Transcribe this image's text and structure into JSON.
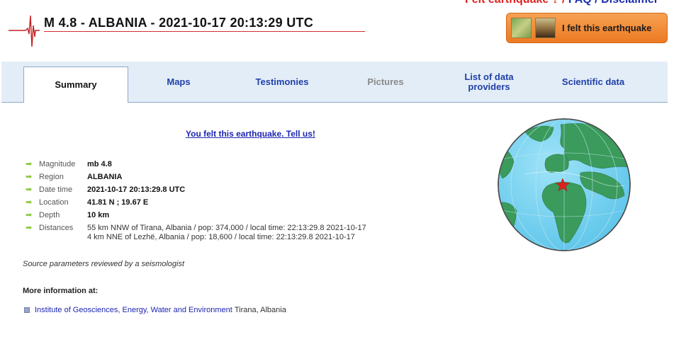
{
  "top_links": {
    "felt": "Felt earthquake ?",
    "faq": "FAQ",
    "disclaimer": "Disclaimer"
  },
  "header": {
    "title": "M 4.8 - ALBANIA - 2021-10-17 20:13:29 UTC",
    "felt_button": "I felt this earthquake"
  },
  "tabs": [
    {
      "label": "Summary"
    },
    {
      "label": "Maps"
    },
    {
      "label": "Testimonies"
    },
    {
      "label": "Pictures"
    },
    {
      "label": "List of data providers"
    },
    {
      "label": "Scientific data"
    }
  ],
  "tell_us": "You felt this earthquake. Tell us!",
  "details": {
    "magnitude": {
      "label": "Magnitude",
      "value": "mb 4.8"
    },
    "region": {
      "label": "Region",
      "value": "ALBANIA"
    },
    "date_time": {
      "label": "Date time",
      "value": "2021-10-17 20:13:29.8 UTC"
    },
    "location": {
      "label": "Location",
      "value": "41.81 N ; 19.67 E"
    },
    "depth": {
      "label": "Depth",
      "value": "10 km"
    },
    "distances": {
      "label": "Distances",
      "line1": "55 km NNW of Tirana, Albania / pop: 374,000 / local time: 22:13:29.8 2021-10-17",
      "line2": "4 km NNE of Lezhë, Albania / pop: 18,600 / local time: 22:13:29.8 2021-10-17"
    }
  },
  "source_note": "Source parameters reviewed by a seismologist",
  "more_info": {
    "heading": "More information at:",
    "institute_link": "Institute of Geosciences, Energy, Water and Environment",
    "institute_place": "Tirana, Albania"
  },
  "colors": {
    "accent": "#1f3fa8",
    "land": "#3a9b5c",
    "ocean": "#7fd6f2",
    "epicenter": "#e02020"
  }
}
